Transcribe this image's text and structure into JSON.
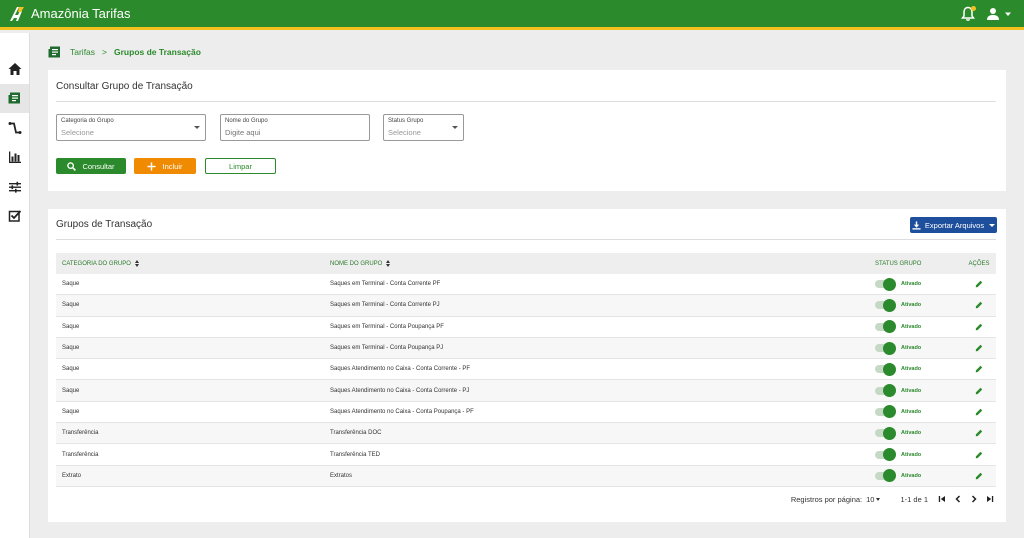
{
  "app": {
    "title": "Amazônia Tarifas",
    "colors": {
      "primary": "#2b8a2b",
      "accent": "#f3c01d",
      "orange": "#f08a00",
      "blue": "#1d4f9c"
    }
  },
  "topbar": {
    "icons": [
      "notification-bell-icon",
      "user-icon",
      "chevron-down-icon"
    ]
  },
  "sidebar": {
    "items": [
      {
        "icon": "home-icon"
      },
      {
        "icon": "receipt-icon",
        "active": true
      },
      {
        "icon": "route-icon"
      },
      {
        "icon": "bar-chart-icon"
      },
      {
        "icon": "sliders-icon"
      },
      {
        "icon": "checklist-icon"
      }
    ]
  },
  "breadcrumb": {
    "parent": "Tarifas",
    "separator": ">",
    "current": "Grupos de Transação"
  },
  "search": {
    "title": "Consultar Grupo de Transação",
    "fields": {
      "category": {
        "label": "Categoria do Grupo",
        "value": "Selecione"
      },
      "name": {
        "label": "Nome do Grupo",
        "placeholder": "Digite aqui"
      },
      "status": {
        "label": "Status Grupo",
        "value": "Selecione"
      }
    },
    "buttons": {
      "consult": "Consultar",
      "include": "Incluir",
      "clear": "Limpar"
    }
  },
  "results": {
    "title": "Grupos de Transação",
    "export_label": "Exportar Arquivos",
    "columns": [
      "CATEGORIA DO GRUPO",
      "NOME DO GRUPO",
      "STATUS GRUPO",
      "AÇÕES"
    ],
    "rows": [
      {
        "category": "Saque",
        "name": "Saques em Terminal - Conta Corrente PF",
        "status": "Ativado",
        "active": true
      },
      {
        "category": "Saque",
        "name": "Saques em Terminal - Conta Corrente PJ",
        "status": "Ativado",
        "active": true
      },
      {
        "category": "Saque",
        "name": "Saques em Terminal - Conta Poupança PF",
        "status": "Ativado",
        "active": true
      },
      {
        "category": "Saque",
        "name": "Saques em Terminal - Conta Poupança PJ",
        "status": "Ativado",
        "active": true
      },
      {
        "category": "Saque",
        "name": "Saques Atendimento no Caixa - Conta Corrente - PF",
        "status": "Ativado",
        "active": true
      },
      {
        "category": "Saque",
        "name": "Saques Atendimento no Caixa - Conta Corrente - PJ",
        "status": "Ativado",
        "active": true
      },
      {
        "category": "Saque",
        "name": "Saques Atendimento no Caixa - Conta Poupança - PF",
        "status": "Ativado",
        "active": true
      },
      {
        "category": "Transferência",
        "name": "Transferência DOC",
        "status": "Ativado",
        "active": true
      },
      {
        "category": "Transferência",
        "name": "Transferência TED",
        "status": "Ativado",
        "active": true
      },
      {
        "category": "Extrato",
        "name": "Extratos",
        "status": "Ativado",
        "active": true
      }
    ],
    "paginator": {
      "label": "Registros por página:",
      "page_size": "10",
      "range": "1-1 de 1"
    }
  }
}
